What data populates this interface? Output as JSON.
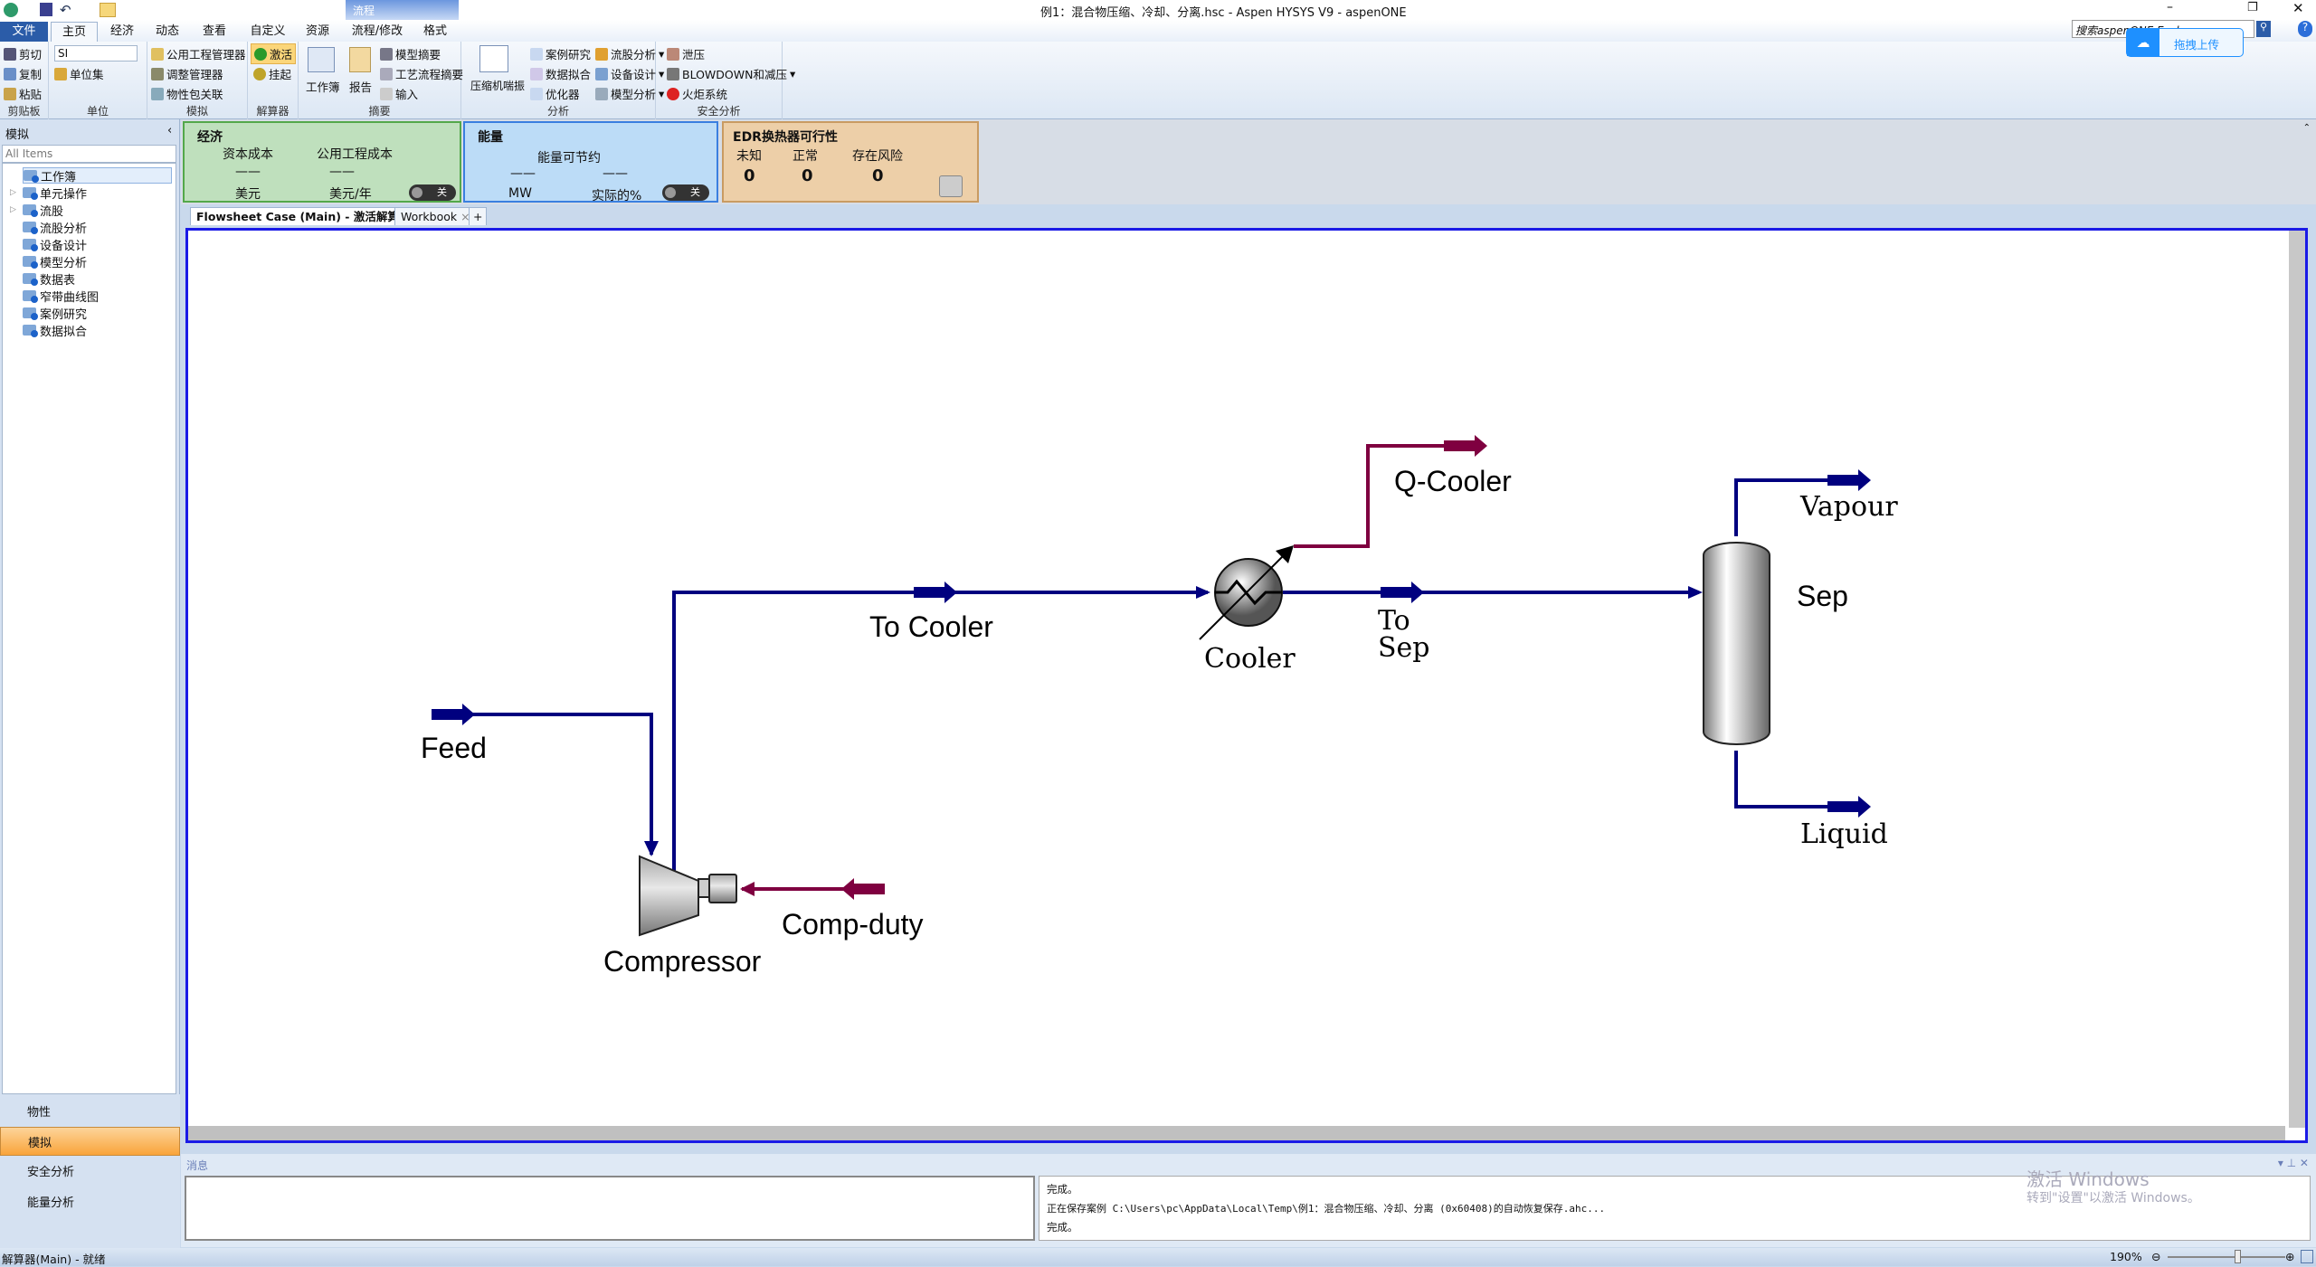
{
  "window": {
    "title": "例1：混合物压缩、冷却、分离.hsc - Aspen HYSYS V9 - aspenONE",
    "search_placeholder": "搜索aspenONE Exchange",
    "upload_label": "拖拽上传",
    "context_tab": "流程"
  },
  "tabs": [
    "文件",
    "主页",
    "经济",
    "动态",
    "查看",
    "自定义",
    "资源",
    "流程/修改",
    "格式"
  ],
  "ribbon": {
    "clipboard": {
      "label": "剪贴板",
      "items": [
        "剪切",
        "复制",
        "粘贴"
      ]
    },
    "units": {
      "label": "单位",
      "select": "SI",
      "unit_set": "单位集"
    },
    "simulation": {
      "label": "模拟",
      "items": [
        "公用工程管理器",
        "调整管理器",
        "物性包关联"
      ]
    },
    "solver": {
      "label": "解算器",
      "items": [
        "激活",
        "挂起"
      ]
    },
    "summary": {
      "label": "摘要",
      "items": [
        "工作簿",
        "报告",
        "模型摘要",
        "工艺流程摘要",
        "输入"
      ]
    },
    "analysis": {
      "label": "分析",
      "items": [
        "压缩机喘振",
        "案例研究",
        "数据拟合",
        "优化器",
        "流股分析",
        "设备设计",
        "模型分析"
      ]
    },
    "safety": {
      "label": "安全分析",
      "items": [
        "泄压",
        "BLOWDOWN和减压",
        "火炬系统"
      ]
    }
  },
  "dashboard": {
    "economics": {
      "title": "经济",
      "cols": [
        "资本成本",
        "公用工程成本"
      ],
      "values": [
        "——",
        "——"
      ],
      "units": [
        "美元",
        "美元/年"
      ],
      "toggle": "关",
      "color": "#bfe0bd"
    },
    "energy": {
      "title": "能量",
      "subtitle": "能量可节约",
      "values": [
        "——",
        "——"
      ],
      "units": [
        "MW",
        "实际的%"
      ],
      "toggle": "关",
      "color": "#bcdcf7"
    },
    "edr": {
      "title": "EDR换热器可行性",
      "cols": [
        "未知",
        "正常",
        "存在风险"
      ],
      "values": [
        "0",
        "0",
        "0"
      ],
      "color": "#edcfa8"
    }
  },
  "left_panel": {
    "title": "模拟",
    "filter": "All Items",
    "tree": [
      "工作簿",
      "单元操作",
      "流股",
      "流股分析",
      "设备设计",
      "模型分析",
      "数据表",
      "窄带曲线图",
      "案例研究",
      "数据拟合"
    ],
    "nav": [
      "物性",
      "模拟",
      "安全分析",
      "能量分析"
    ]
  },
  "doc_tabs": [
    "Flowsheet Case (Main) - 激活解算器",
    "Workbook"
  ],
  "flowsheet": {
    "labels": {
      "feed": "Feed",
      "to_cooler": "To Cooler",
      "cooler": "Cooler",
      "to_sep_1": "To",
      "to_sep_2": "Sep",
      "q_cooler": "Q-Cooler",
      "vapour": "Vapour",
      "sep": "Sep",
      "liquid": "Liquid",
      "compressor": "Compressor",
      "comp_duty": "Comp-duty"
    },
    "colors": {
      "material": "#00007f",
      "energy": "#7f0040"
    }
  },
  "messages": {
    "title": "消息",
    "lines": [
      "完成。",
      "正在保存案例 C:\\Users\\pc\\AppData\\Local\\Temp\\例1：混合物压缩、冷却、分离 (0x60408)的自动恢复保存.ahc...",
      "完成。"
    ],
    "watermark_1": "激活 Windows",
    "watermark_2": "转到\"设置\"以激活 Windows。"
  },
  "status": {
    "text": "解算器(Main) - 就绪",
    "zoom": "190%"
  }
}
